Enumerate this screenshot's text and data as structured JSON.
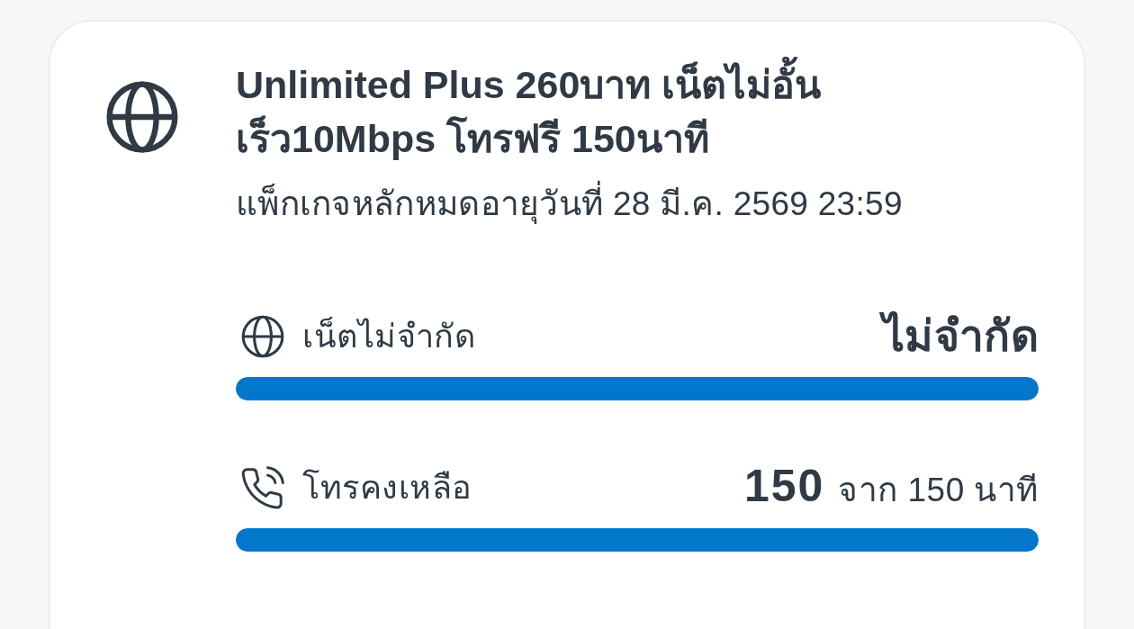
{
  "package": {
    "title": "Unlimited Plus 260บาท เน็ตไม่อั้น เร็ว10Mbps โทรฟรี 150นาที",
    "expiry": "แพ็กเกจหลักหมดอายุวันที่ 28 มี.ค. 2569 23:59",
    "usage": [
      {
        "kind": "data",
        "label": "เน็ตไม่จำกัด",
        "value": "ไม่จำกัด",
        "level": 1
      },
      {
        "kind": "voice",
        "label": "โทรคงเหลือ",
        "value": "**150** จาก 150 นาที",
        "level": 1
      }
    ]
  }
}
